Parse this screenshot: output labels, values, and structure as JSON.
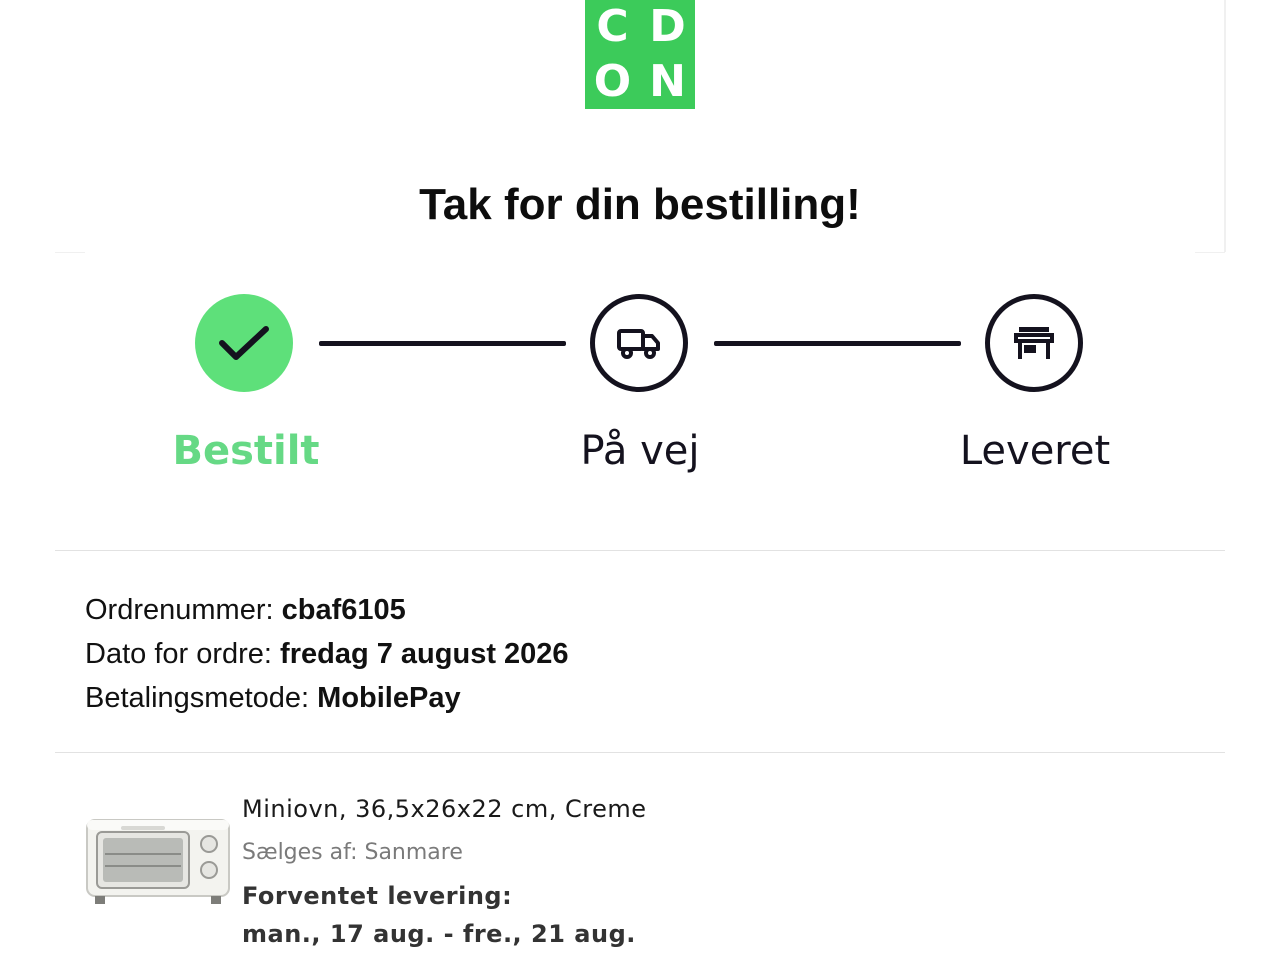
{
  "brand": {
    "letters": [
      "C",
      "D",
      "O",
      "N"
    ],
    "color": "#3ccb5a"
  },
  "headline": "Tak for din bestilling!",
  "tracker": {
    "steps": [
      {
        "label": "Bestilt",
        "icon": "check-icon",
        "status": "done"
      },
      {
        "label": "På vej",
        "icon": "truck-icon",
        "status": "pending"
      },
      {
        "label": "Leveret",
        "icon": "store-icon",
        "status": "pending"
      }
    ],
    "done_color": "#5ee07a",
    "line_color": "#14121e"
  },
  "order": {
    "number_label": "Ordrenummer:",
    "number_value": "cbaf6105",
    "date_label": "Dato for ordre:",
    "date_value": "fredag 7 august 2026",
    "payment_label": "Betalingsmetode:",
    "payment_value": "MobilePay"
  },
  "product": {
    "image_icon": "mini-oven-image",
    "name": "Miniovn, 36,5x26x22 cm, Creme",
    "seller": "Sælges af: Sanmare",
    "delivery_label": "Forventet levering:",
    "delivery_range": "man., 17 aug. - fre., 21 aug."
  }
}
